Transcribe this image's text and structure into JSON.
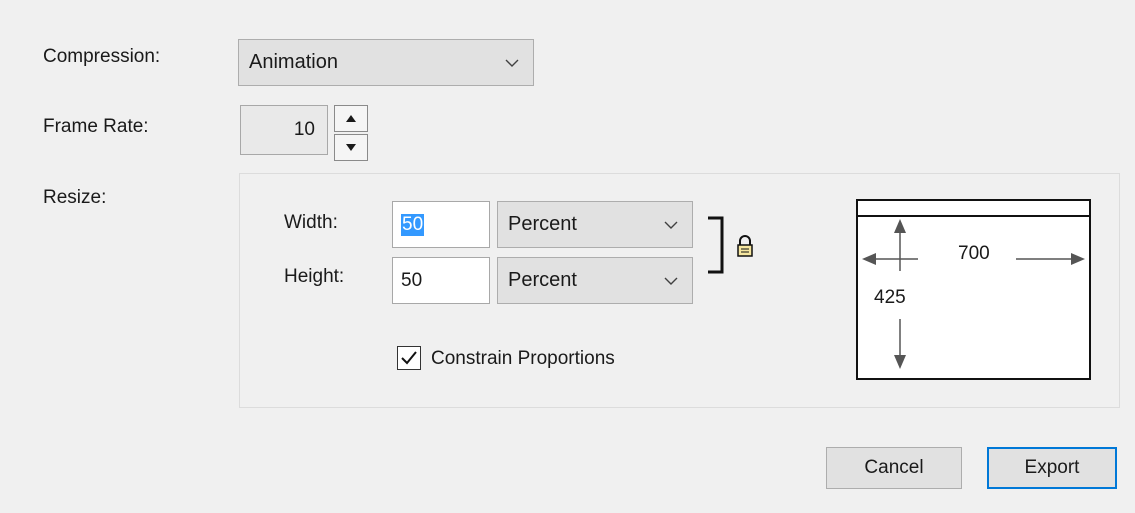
{
  "compression": {
    "label": "Compression:",
    "value": "Animation",
    "chevron_icon": "chevron-down-icon"
  },
  "frame_rate": {
    "label": "Frame Rate:",
    "value": "10",
    "up_icon": "arrow-up-icon",
    "down_icon": "arrow-down-icon"
  },
  "resize": {
    "label": "Resize:",
    "width": {
      "label": "Width:",
      "value": "50",
      "unit": "Percent"
    },
    "height": {
      "label": "Height:",
      "value": "50",
      "unit": "Percent"
    },
    "lock_icon": "lock-icon",
    "constrain": {
      "label": "Constrain Proportions",
      "checked": true
    },
    "preview": {
      "width_value": "700",
      "height_value": "425"
    }
  },
  "buttons": {
    "cancel": "Cancel",
    "export": "Export"
  },
  "colors": {
    "selection": "#3399ff",
    "default_button_border": "#0078d7",
    "background": "#f0f0f0"
  }
}
